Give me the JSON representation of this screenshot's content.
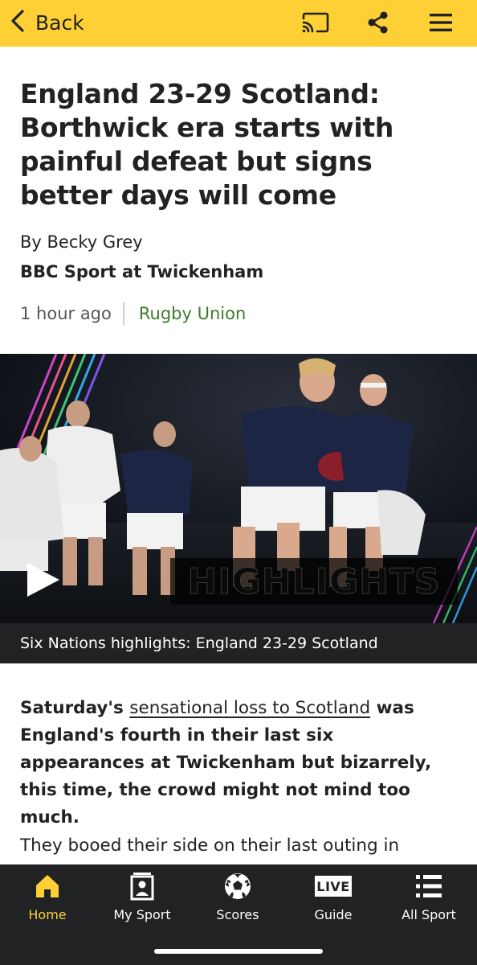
{
  "topbar": {
    "back_label": "Back",
    "icons": [
      "chevron-left-icon",
      "cast-icon",
      "share-icon",
      "menu-icon"
    ],
    "background": "#fed035"
  },
  "article": {
    "headline": "England 23-29 Scotland: Borthwick era starts with painful defeat but signs better days will come",
    "byline": "By Becky Grey",
    "affiliation": "BBC Sport at Twickenham",
    "time": "1 hour ago",
    "topic": "Rugby Union",
    "topic_color": "#407a2c"
  },
  "media": {
    "overlay_text": "HIGHLIGHTS",
    "caption": "Six Nations highlights: England 23-29 Scotland"
  },
  "body": {
    "lead_start": "Saturday's ",
    "lead_link": "sensational loss to Scotland",
    "lead_end": " was England's fourth in their last six appearances at Twickenham but bizarrely, this time, the crowd might not mind too much.",
    "para1": "They booed their side on their last outing in"
  },
  "bottom_nav": {
    "items": [
      {
        "label": "Home",
        "icon": "home-icon",
        "active": true
      },
      {
        "label": "My Sport",
        "icon": "my-sport-icon",
        "active": false
      },
      {
        "label": "Scores",
        "icon": "football-icon",
        "active": false
      },
      {
        "label": "Guide",
        "icon": "live-icon",
        "active": false,
        "icon_text": "LIVE"
      },
      {
        "label": "All Sport",
        "icon": "list-icon",
        "active": false
      }
    ],
    "active_color": "#fed035",
    "background": "#202224"
  }
}
